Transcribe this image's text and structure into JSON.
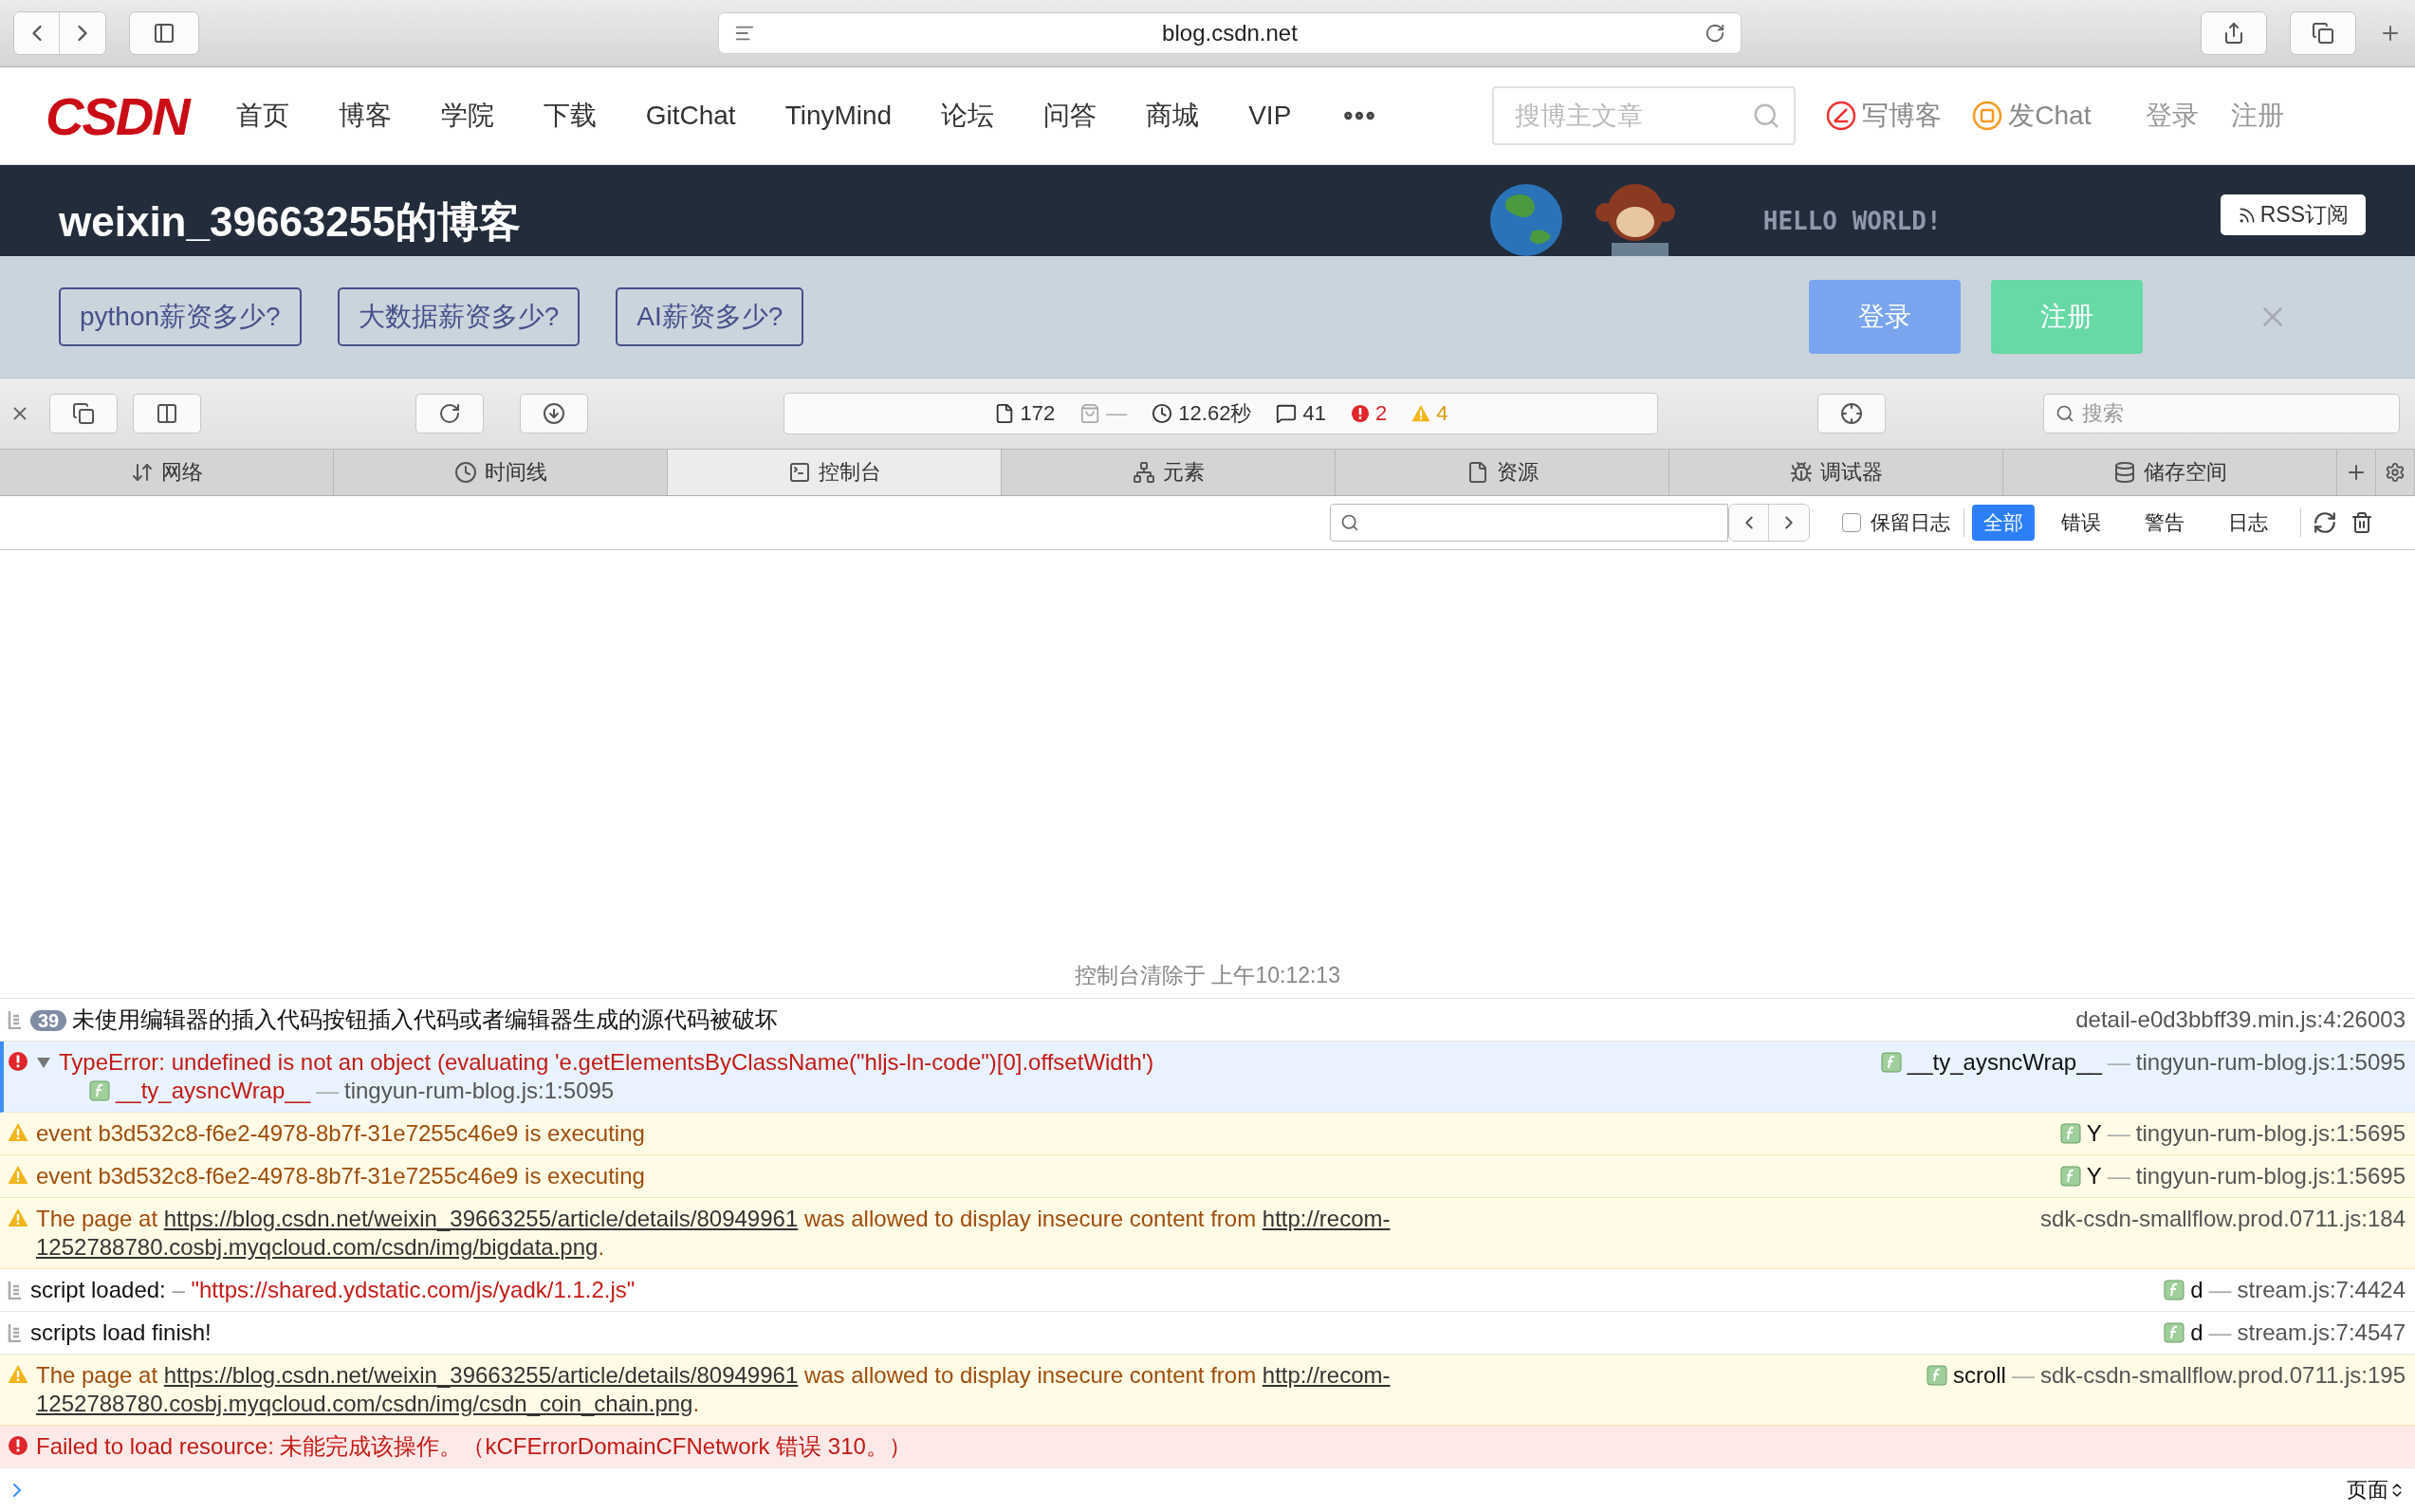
{
  "browser": {
    "address": "blog.csdn.net"
  },
  "site_nav": {
    "logo": "CSDN",
    "items": [
      "首页",
      "博客",
      "学院",
      "下载",
      "GitChat",
      "TinyMind",
      "论坛",
      "问答",
      "商城",
      "VIP"
    ],
    "search": {
      "placeholder": "搜博主文章"
    },
    "actions": [
      {
        "kind": "write",
        "label": "写博客"
      },
      {
        "kind": "chat",
        "label": "发Chat"
      }
    ],
    "login": "登录",
    "register": "注册"
  },
  "blog_banner": {
    "title": "weixin_39663255的博客",
    "slogan": "HELLO WORLD!",
    "rss": "RSS订阅",
    "promo_tags": [
      "python薪资多少?",
      "大数据薪资多少?",
      "AI薪资多少?"
    ],
    "login_button": "登录",
    "register_button": "注册"
  },
  "devtools": {
    "stats": [
      {
        "kind": "resources",
        "text": "172"
      },
      {
        "kind": "size",
        "text": "—"
      },
      {
        "kind": "time",
        "text": "12.62秒"
      },
      {
        "kind": "messages",
        "text": "41"
      },
      {
        "kind": "errors",
        "text": "2"
      },
      {
        "kind": "warnings",
        "text": "4"
      }
    ],
    "search": {
      "placeholder": "搜索"
    },
    "tabs": [
      {
        "label": "网络",
        "selected": false
      },
      {
        "label": "时间线",
        "selected": false
      },
      {
        "label": "控制台",
        "selected": true
      },
      {
        "label": "元素",
        "selected": false
      },
      {
        "label": "资源",
        "selected": false
      },
      {
        "label": "调试器",
        "selected": false
      },
      {
        "label": "储存空间",
        "selected": false
      }
    ],
    "filter": {
      "preserve_log": {
        "label": "保留日志",
        "checked": false
      },
      "levels": [
        {
          "label": "全部",
          "selected": true
        },
        {
          "label": "错误",
          "selected": false
        },
        {
          "label": "警告",
          "selected": false
        },
        {
          "label": "日志",
          "selected": false
        }
      ]
    }
  },
  "console": {
    "cleared": "控制台清除于 上午10:12:13",
    "messages": [
      {
        "kind": "log",
        "count": "39",
        "selected": false,
        "parts": [
          {
            "kind": "text",
            "text": "未使用编辑器的插入代码按钮插入代码或者编辑器生成的源代码被破坏"
          }
        ],
        "source": {
          "location": "detail-e0d3bbff39.min.js:4:26003"
        }
      },
      {
        "kind": "error",
        "selected": true,
        "expanded": true,
        "parts": [
          {
            "kind": "text",
            "text": "TypeError: undefined is not an object (evaluating 'e.getElementsByClassName(\"hljs-ln-code\")[0].offsetWidth')"
          }
        ],
        "source": {
          "function": "__ty_aysncWrap__",
          "separator": "—",
          "location": "tingyun-rum-blog.js:1:5095"
        },
        "stack": [
          {
            "function": "__ty_aysncWrap__",
            "separator": "—",
            "location": "tingyun-rum-blog.js:1:5095"
          }
        ]
      },
      {
        "kind": "warning",
        "selected": false,
        "parts": [
          {
            "kind": "text",
            "text": "event b3d532c8-f6e2-4978-8b7f-31e7255c46e9 is executing"
          }
        ],
        "source": {
          "function": "Y",
          "separator": "—",
          "location": "tingyun-rum-blog.js:1:5695"
        }
      },
      {
        "kind": "warning",
        "selected": false,
        "parts": [
          {
            "kind": "text",
            "text": "event b3d532c8-f6e2-4978-8b7f-31e7255c46e9 is executing"
          }
        ],
        "source": {
          "function": "Y",
          "separator": "—",
          "location": "tingyun-rum-blog.js:1:5695"
        }
      },
      {
        "kind": "warning",
        "selected": false,
        "parts": [
          {
            "kind": "text",
            "text": "The page at "
          },
          {
            "kind": "link",
            "text": "https://blog.csdn.net/weixin_39663255/article/details/80949961"
          },
          {
            "kind": "text",
            "text": " was allowed to display insecure content from "
          },
          {
            "kind": "link",
            "text": "http://recom-"
          },
          {
            "kind": "link",
            "text": "1252788780.cosbj.myqcloud.com/csdn/img/bigdata.png"
          },
          {
            "kind": "text",
            "text": "."
          }
        ],
        "source": {
          "location": "sdk-csdn-smallflow.prod.0711.js:184"
        }
      },
      {
        "kind": "log",
        "selected": false,
        "parts": [
          {
            "kind": "text",
            "text": "script loaded: "
          },
          {
            "kind": "dim",
            "text": "–"
          },
          {
            "kind": "string",
            "text": " \"https://shared.ydstatic.com/js/yadk/1.1.2.js\""
          }
        ],
        "source": {
          "function": "d",
          "separator": "—",
          "location": "stream.js:7:4424"
        }
      },
      {
        "kind": "log",
        "selected": false,
        "parts": [
          {
            "kind": "text",
            "text": "scripts load finish!"
          }
        ],
        "source": {
          "function": "d",
          "separator": "—",
          "location": "stream.js:7:4547"
        }
      },
      {
        "kind": "warning",
        "selected": false,
        "parts": [
          {
            "kind": "text",
            "text": "The page at "
          },
          {
            "kind": "link",
            "text": "https://blog.csdn.net/weixin_39663255/article/details/80949961"
          },
          {
            "kind": "text",
            "text": " was allowed to display insecure content from "
          },
          {
            "kind": "link",
            "text": "http://recom-"
          },
          {
            "kind": "link",
            "text": "1252788780.cosbj.myqcloud.com/csdn/img/csdn_coin_chain.png"
          },
          {
            "kind": "text",
            "text": "."
          }
        ],
        "source": {
          "function": "scroll",
          "separator": "—",
          "location": "sdk-csdn-smallflow.prod.0711.js:195"
        }
      },
      {
        "kind": "error",
        "selected": false,
        "parts": [
          {
            "kind": "text",
            "text": "Failed to load resource: 未能完成该操作。（kCFErrorDomainCFNetwork 错误 310。）"
          }
        ]
      }
    ],
    "context": "页面"
  }
}
